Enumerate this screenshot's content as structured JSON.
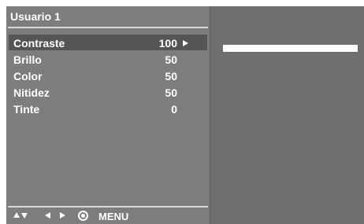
{
  "menu": {
    "title": "Usuario 1",
    "items": [
      {
        "label": "Contraste",
        "value": "100",
        "selected": true
      },
      {
        "label": "Brillo",
        "value": "50"
      },
      {
        "label": "Color",
        "value": "50"
      },
      {
        "label": "Nitidez",
        "value": "50"
      },
      {
        "label": "Tinte",
        "value": "0"
      }
    ]
  },
  "footer": {
    "menu_label": "MENU",
    "icons": [
      "up-down-arrows-icon",
      "left-right-arrows-icon",
      "ok-button-icon"
    ]
  },
  "level_bar": {
    "level_fraction": 1.0
  },
  "colors": {
    "panel_bg": "#7d7d7d",
    "selected_row": "#555555",
    "text": "#ffffff"
  }
}
